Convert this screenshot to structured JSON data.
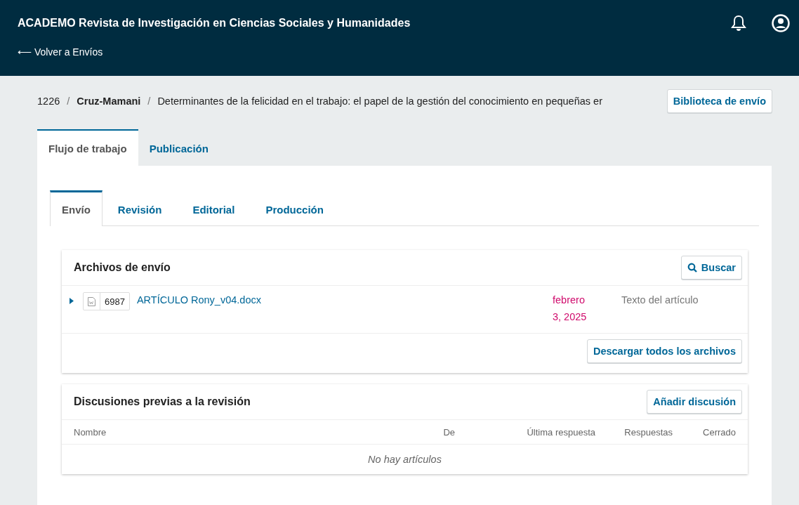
{
  "header": {
    "title": "ACADEMO Revista de Investigación en Ciencias Sociales y Humanidades",
    "back_link": "⟵ Volver a Envíos"
  },
  "breadcrumb": {
    "id": "1226",
    "separators": [
      "/",
      "/"
    ],
    "author": "Cruz-Mamani",
    "title": "Determinantes de la felicidad en el trabajo: el papel de la gestión del conocimiento en pequeñas er",
    "library_button": "Biblioteca de envío"
  },
  "main_tabs": [
    {
      "label": "Flujo de trabajo",
      "selected": true
    },
    {
      "label": "Publicación",
      "selected": false
    }
  ],
  "stage_tabs": [
    {
      "label": "Envío",
      "selected": true
    },
    {
      "label": "Revisión",
      "selected": false
    },
    {
      "label": "Editorial",
      "selected": false
    },
    {
      "label": "Producción",
      "selected": false
    }
  ],
  "files_panel": {
    "title": "Archivos de envío",
    "search_button": "Buscar",
    "files": [
      {
        "id": "6987",
        "name": "ARTÍCULO Rony_v04.docx",
        "date": "febrero 3, 2025",
        "type": "Texto del artículo",
        "expanded": false
      }
    ],
    "download_button": "Descargar todos los archivos"
  },
  "discussions_panel": {
    "title": "Discusiones previas a la revisión",
    "add_button": "Añadir discusión",
    "columns": [
      "Nombre",
      "De",
      "Última respuesta",
      "Respuestas",
      "Cerrado"
    ],
    "empty_text": "No hay artículos"
  }
}
